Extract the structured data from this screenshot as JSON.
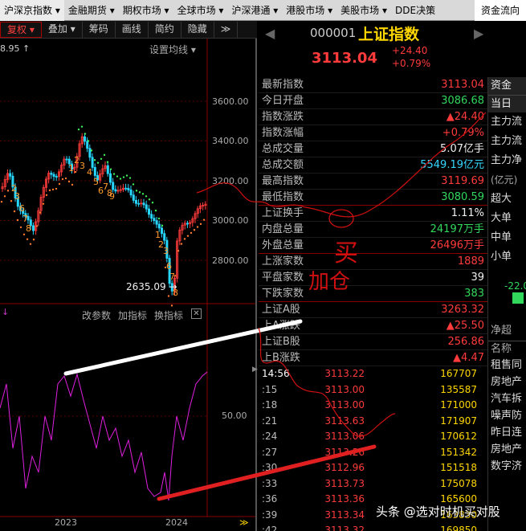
{
  "menu": [
    "沪深京指数",
    "金融期货",
    "期权市场",
    "全球市场",
    "沪深港通",
    "港股市场",
    "美股市场",
    "DDE决策",
    "资金流向"
  ],
  "toolbar": [
    "复权",
    "叠加",
    "筹码",
    "画线",
    "简约",
    "隐藏",
    "≫"
  ],
  "chart": {
    "price_top_left": "8.95",
    "ma_setting": "设置均线",
    "y_ticks": [
      "3600.00",
      "3400.00",
      "3200.00",
      "3000.00",
      "2800.00"
    ],
    "low_label": "2635.09",
    "ind_buttons": [
      "改参数",
      "加指标",
      "换指标"
    ],
    "ind_tick": "50.00",
    "x_ticks": [
      "2023",
      "2024"
    ],
    "td_labels": [
      "2",
      "3",
      "6",
      "7",
      "8",
      "1",
      "2",
      "3",
      "4",
      "5",
      "6",
      "7",
      "8",
      "9",
      "1",
      "2",
      "3",
      "6",
      "7",
      "8"
    ]
  },
  "header": {
    "code": "000001",
    "name": "上证指数",
    "price": "3113.04",
    "change": "+24.40",
    "change_pct": "+0.79%"
  },
  "quotes": [
    {
      "label": "最新指数",
      "value": "3113.04",
      "cls": "r"
    },
    {
      "label": "今日开盘",
      "value": "3086.68",
      "cls": "g"
    },
    {
      "label": "指数涨跌",
      "value": "▲24.40",
      "cls": "r"
    },
    {
      "label": "指数涨幅",
      "value": "+0.79%",
      "cls": "r"
    },
    {
      "label": "总成交量",
      "value": "5.07亿手",
      "cls": "w"
    },
    {
      "label": "总成交额",
      "value": "5549.19亿元",
      "cls": "c"
    },
    {
      "label": "最高指数",
      "value": "3119.69",
      "cls": "r"
    },
    {
      "label": "最低指数",
      "value": "3080.59",
      "cls": "g",
      "sep": true
    },
    {
      "label": "上证换手",
      "value": "1.11%",
      "cls": "w"
    },
    {
      "label": "内盘总量",
      "value": "24197万手",
      "cls": "g"
    },
    {
      "label": "外盘总量",
      "value": "26496万手",
      "cls": "r",
      "sep": true
    },
    {
      "label": "上涨家数",
      "value": "1889",
      "cls": "r"
    },
    {
      "label": "平盘家数",
      "value": "39",
      "cls": "w"
    },
    {
      "label": "下跌家数",
      "value": "383",
      "cls": "g",
      "sep": true
    },
    {
      "label": "上证A股",
      "value": "3263.32",
      "cls": "r"
    },
    {
      "label": "上A涨跌",
      "value": "▲25.50",
      "cls": "r"
    },
    {
      "label": "上证B股",
      "value": "256.86",
      "cls": "r"
    },
    {
      "label": "上B涨跌",
      "value": "▲4.47",
      "cls": "r"
    }
  ],
  "ticks": [
    {
      "t": "14:56",
      "p": "3113.22",
      "v": "167707"
    },
    {
      "t": ":15",
      "p": "3113.00",
      "v": "135587"
    },
    {
      "t": ":18",
      "p": "3113.00",
      "v": "171000"
    },
    {
      "t": ":21",
      "p": "3113.63",
      "v": "171907"
    },
    {
      "t": ":24",
      "p": "3113.06",
      "v": "170612"
    },
    {
      "t": ":27",
      "p": "3113.26",
      "v": "151342"
    },
    {
      "t": ":30",
      "p": "3112.96",
      "v": "151518"
    },
    {
      "t": ":33",
      "p": "3113.73",
      "v": "175078"
    },
    {
      "t": ":36",
      "p": "3113.36",
      "v": "165600"
    },
    {
      "t": ":39",
      "p": "3113.34",
      "v": "163830"
    },
    {
      "t": ":42",
      "p": "3113.32",
      "v": "169850"
    }
  ],
  "far_panel": {
    "tabs": [
      "资金",
      "当日"
    ],
    "flows": [
      "主力流",
      "主力流",
      "主力净"
    ],
    "unit": "(亿元)",
    "sizes": [
      "超大",
      "大单",
      "中单",
      "小单"
    ],
    "bar_value": "-22.0",
    "net": "净超",
    "list_head": "名称",
    "list": [
      "租售同",
      "房地产",
      "汽车拆",
      "噪声防",
      "昨日连",
      "房地产",
      "数字济"
    ]
  },
  "annotations": {
    "buy": "买",
    "add": "加仓"
  },
  "watermark": "头条 @选对时机买对股"
}
